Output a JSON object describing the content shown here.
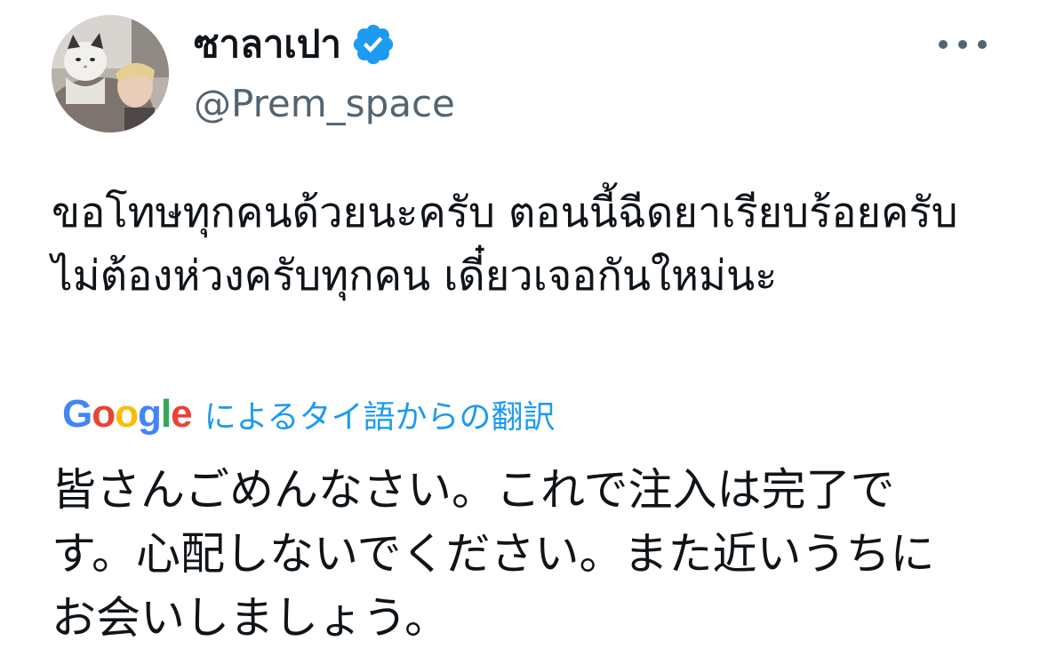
{
  "author": {
    "display_name": "ซาลาเปา",
    "handle": "@Prem_space",
    "verified": true,
    "verified_color": "#1d9bf0",
    "avatar_icon": "profile-photo-with-cat"
  },
  "menu": {
    "more_icon": "ellipsis-horizontal-icon"
  },
  "tweet": {
    "text": "ขอโทษทุกคนด้วยนะครับ ตอนนี้ฉีดยาเรียบร้อยครับ ไม่ต้องห่วงครับทุกคน เดี๋ยวเจอกันใหม่นะ"
  },
  "translation": {
    "provider_logo_letters": [
      "G",
      "o",
      "o",
      "g",
      "l",
      "e"
    ],
    "label": "によるタイ語からの翻訳",
    "label_color": "#1d9bf0",
    "text": "皆さんごめんなさい。これで注入は完了です。心配しないでください。また近いうちにお会いしましょう。"
  }
}
